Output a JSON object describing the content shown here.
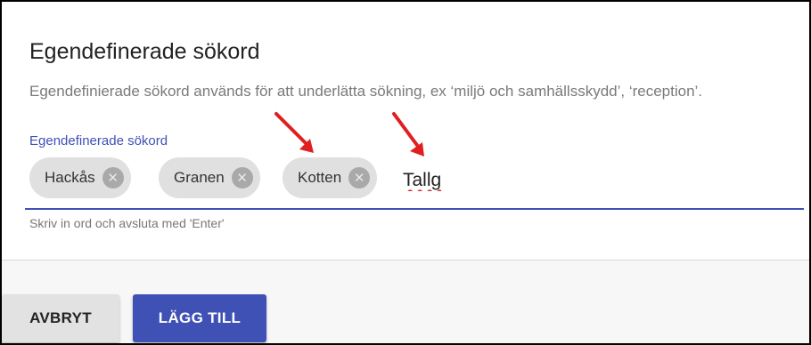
{
  "dialog": {
    "title": "Egendefinerade sökord",
    "description": "Egendefinierade sökord används för att underlätta sökning, ex ‘miljö och samhällsskydd’, ‘reception’.",
    "field_label": "Egendefinerade sökord",
    "chips": [
      {
        "label": "Hackås"
      },
      {
        "label": "Granen"
      },
      {
        "label": "Kotten"
      }
    ],
    "input_value": "Tallg",
    "hint": "Skriv in ord och avsluta med 'Enter'"
  },
  "actions": {
    "cancel_label": "AVBRYT",
    "add_label": "LÄGG TILL"
  },
  "annotations": {
    "arrow_color": "#e02020"
  },
  "colors": {
    "primary": "#3f51b5",
    "chip_background": "#e0e0e0"
  }
}
